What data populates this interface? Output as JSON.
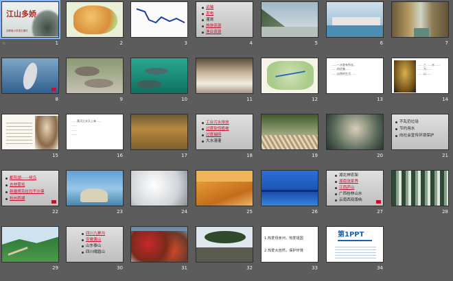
{
  "slides": [
    {
      "number": "1",
      "title": "江山多娇",
      "subtitle": "苏教版小学语文课件"
    },
    {
      "number": "2"
    },
    {
      "number": "3"
    },
    {
      "number": "4",
      "bullets": [
        "运输",
        "发电",
        "灌溉",
        "旅游资源",
        "渔业资源"
      ]
    },
    {
      "number": "5"
    },
    {
      "number": "6"
    },
    {
      "number": "7"
    },
    {
      "number": "8"
    },
    {
      "number": "9"
    },
    {
      "number": "10"
    },
    {
      "number": "11"
    },
    {
      "number": "12"
    },
    {
      "number": "13",
      "text": "……一水各有所长，\n……的优美……\n……自然的生活……"
    },
    {
      "number": "14",
      "text": "……三……水……\n……为……\n……以……"
    },
    {
      "number": "15"
    },
    {
      "number": "16",
      "text": "……黄河之水天上来……\n……\n……\n……"
    },
    {
      "number": "17"
    },
    {
      "number": "18",
      "bullets": [
        "工业污水排放",
        "过度砍伐植被",
        "过度捕捞",
        "大水漫灌"
      ]
    },
    {
      "number": "19"
    },
    {
      "number": "20"
    },
    {
      "number": "21",
      "bullets": [
        "不乱扔垃圾",
        "节约用水",
        "向社会宣传环境保护"
      ]
    },
    {
      "number": "22",
      "bullets": [
        "鄱阳湖——候鸟",
        "吉林雾凇",
        "新疆塔克拉玛干沙漠",
        "杭州西湖"
      ]
    },
    {
      "number": "23"
    },
    {
      "number": "24"
    },
    {
      "number": "25"
    },
    {
      "number": "26"
    },
    {
      "number": "27",
      "bullets": [
        "湖北神农架",
        "湖南张家界",
        "江西庐山",
        "广西桂林山水",
        "云南西双版纳"
      ]
    },
    {
      "number": "28"
    },
    {
      "number": "29"
    },
    {
      "number": "30",
      "bullets": [
        "四川九寨沟",
        "安徽黄山",
        "山东泰山",
        "四川峨眉山"
      ]
    },
    {
      "number": "31"
    },
    {
      "number": "32"
    },
    {
      "number": "33",
      "lines": [
        "1.热爱母亲河，热爱祖国",
        "2.热爱大自然，保护环境"
      ]
    },
    {
      "number": "34",
      "logo": "第1PPT"
    }
  ],
  "colors": {
    "bg": "#5c5c5c",
    "accent_red": "#c8102e",
    "selection": "#7fb2ff"
  }
}
